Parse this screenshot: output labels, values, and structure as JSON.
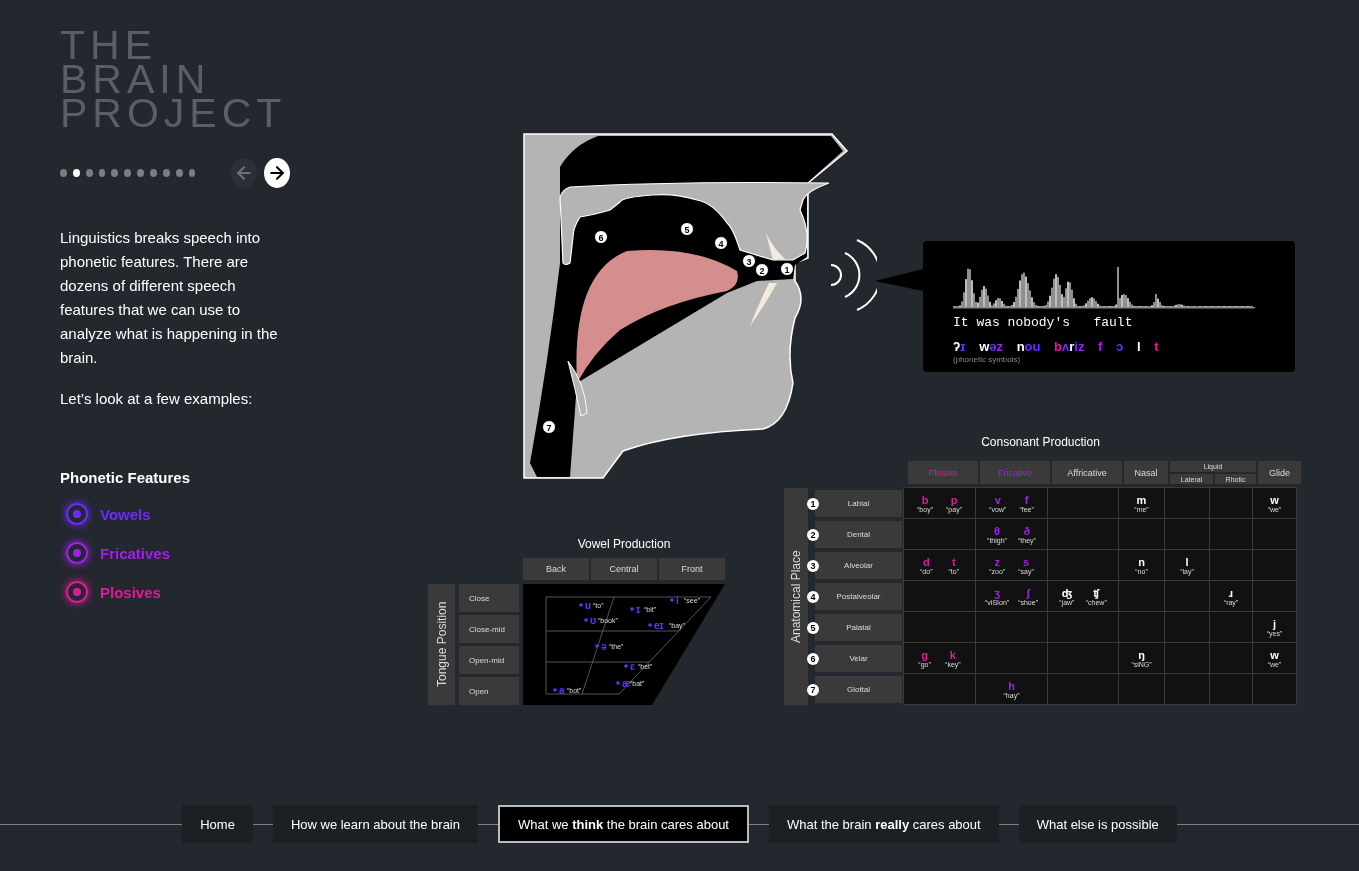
{
  "title": [
    "THE",
    "BRAIN",
    "PROJECT"
  ],
  "pager": {
    "dots": [
      {
        "selected": false
      },
      {
        "selected": true
      },
      {
        "selected": false
      },
      {
        "selected": false
      },
      {
        "selected": false
      },
      {
        "selected": false
      },
      {
        "selected": false
      },
      {
        "selected": false
      },
      {
        "selected": false
      },
      {
        "selected": false
      },
      {
        "selected": false
      }
    ],
    "prev": {
      "disabled": true
    },
    "next": {
      "disabled": false
    }
  },
  "intro": "Linguistics breaks speech into phonetic features. There are dozens of different speech features that we can use to analyze what is happening in the brain.",
  "prompt": "Let’s look at a few examples:",
  "features": {
    "heading": "Phonetic Features",
    "items": [
      {
        "label": "Vowels",
        "kind": "vowel",
        "color": "#6a2cff"
      },
      {
        "label": "Fricatives",
        "kind": "fricative",
        "color": "#a020e8"
      },
      {
        "label": "Plosives",
        "kind": "plosive",
        "color": "#e0199a"
      }
    ]
  },
  "tract": {
    "markers": [
      "1",
      "2",
      "3",
      "4",
      "5",
      "6",
      "7"
    ]
  },
  "speech": {
    "sentence": "It was nobody's   fault",
    "words": [
      {
        "segments": [
          {
            "text": "ʔ",
            "kind": "other"
          },
          {
            "text": "ɪ",
            "kind": "vowel"
          }
        ]
      },
      {
        "segments": [
          {
            "text": "w",
            "kind": "other"
          },
          {
            "text": "ə",
            "kind": "vowel"
          },
          {
            "text": "z",
            "kind": "fricative"
          }
        ]
      },
      {
        "segments": [
          {
            "text": "n",
            "kind": "other"
          },
          {
            "text": "ou",
            "kind": "vowel"
          }
        ]
      },
      {
        "segments": [
          {
            "text": "b",
            "kind": "plosive"
          },
          {
            "text": "ʌ",
            "kind": "vowel"
          },
          {
            "text": "r",
            "kind": "other"
          },
          {
            "text": "i",
            "kind": "vowel"
          },
          {
            "text": "z",
            "kind": "fricative"
          }
        ]
      },
      {
        "segments": [
          {
            "text": "f",
            "kind": "fricative"
          }
        ]
      },
      {
        "segments": [
          {
            "text": "ɔ",
            "kind": "vowel"
          }
        ]
      },
      {
        "segments": [
          {
            "text": "l",
            "kind": "other"
          }
        ]
      },
      {
        "segments": [
          {
            "text": "t",
            "kind": "plosive"
          }
        ]
      }
    ],
    "caption": "(phonetic symbols)"
  },
  "vowel_chart": {
    "title": "Vowel Production",
    "axis_label": "Tongue Position",
    "columns": [
      "Back",
      "Central",
      "Front"
    ],
    "rows": [
      "Close",
      "Close-mid",
      "Open-mid",
      "Open"
    ],
    "vowels": [
      {
        "symbol": "u",
        "example": "“to”"
      },
      {
        "symbol": "ɪ",
        "example": "“bit”"
      },
      {
        "symbol": "i",
        "example": "“see”"
      },
      {
        "symbol": "ʊ",
        "example": "“book”"
      },
      {
        "symbol": "eɪ",
        "example": "“bay”"
      },
      {
        "symbol": "ə",
        "example": "“the”"
      },
      {
        "symbol": "ɛ",
        "example": "“bet”"
      },
      {
        "symbol": "æ",
        "example": "“bat”"
      },
      {
        "symbol": "a",
        "example": "“bot”"
      }
    ]
  },
  "consonant_chart": {
    "title": "Consonant Production",
    "axis_label": "Anatomical Place",
    "group_label": "Liquid",
    "columns": [
      {
        "label": "Plosive",
        "kind": "plosive",
        "group": false
      },
      {
        "label": "Fricative",
        "kind": "fricative",
        "group": false
      },
      {
        "label": "Affricative",
        "kind": "affricative",
        "group": false
      },
      {
        "label": "Nasal",
        "kind": "nasal",
        "group": false
      },
      {
        "label": "Lateral",
        "kind": "lateral",
        "group": true
      },
      {
        "label": "Rhotic",
        "kind": "rhotic",
        "group": true
      },
      {
        "label": "Glide",
        "kind": "glide",
        "group": false
      }
    ],
    "rows": [
      {
        "number": "1",
        "place": "Labial",
        "phones": [
          {
            "symbol": "b",
            "example": "“boy”",
            "kind": "plosive"
          },
          {
            "symbol": "p",
            "example": "“pay”",
            "kind": "plosive"
          },
          {
            "symbol": "v",
            "example": "“vow”",
            "kind": "fricative"
          },
          {
            "symbol": "f",
            "example": "“fee”",
            "kind": "fricative"
          },
          {
            "symbol": "m",
            "example": "“me”",
            "kind": "nasal"
          },
          {
            "symbol": "w",
            "example": "“we”",
            "kind": "glide"
          }
        ]
      },
      {
        "number": "2",
        "place": "Dental",
        "phones": [
          {
            "symbol": "θ",
            "example": "“thigh”",
            "kind": "fricative"
          },
          {
            "symbol": "ð",
            "example": "“they”",
            "kind": "fricative"
          }
        ]
      },
      {
        "number": "3",
        "place": "Alveolar",
        "phones": [
          {
            "symbol": "d",
            "example": "“do”",
            "kind": "plosive"
          },
          {
            "symbol": "t",
            "example": "“to”",
            "kind": "plosive"
          },
          {
            "symbol": "z",
            "example": "“zoo”",
            "kind": "fricative"
          },
          {
            "symbol": "s",
            "example": "“say”",
            "kind": "fricative"
          },
          {
            "symbol": "n",
            "example": "“no”",
            "kind": "nasal"
          },
          {
            "symbol": "l",
            "example": "“lay”",
            "kind": "lateral"
          }
        ]
      },
      {
        "number": "4",
        "place": "Postalveolar",
        "phones": [
          {
            "symbol": "ʒ",
            "example": "“viSIon”",
            "kind": "fricative"
          },
          {
            "symbol": "ʃ",
            "example": "“shoe”",
            "kind": "fricative"
          },
          {
            "symbol": "ʤ",
            "example": "“jaw”",
            "kind": "affricative"
          },
          {
            "symbol": "ʧ",
            "example": "“chew”",
            "kind": "affricative"
          },
          {
            "symbol": "ɹ",
            "example": "“ray”",
            "kind": "rhotic"
          }
        ]
      },
      {
        "number": "5",
        "place": "Palatal",
        "phones": [
          {
            "symbol": "j",
            "example": "“yes”",
            "kind": "glide"
          }
        ]
      },
      {
        "number": "6",
        "place": "Velar",
        "phones": [
          {
            "symbol": "g",
            "example": "“go”",
            "kind": "plosive"
          },
          {
            "symbol": "k",
            "example": "“key”",
            "kind": "plosive"
          },
          {
            "symbol": "ŋ",
            "example": "“siNG”",
            "kind": "nasal"
          },
          {
            "symbol": "w",
            "example": "“we”",
            "kind": "glide"
          }
        ]
      },
      {
        "number": "7",
        "place": "Glottal",
        "phones": [
          {
            "symbol": "h",
            "example": "“hay”",
            "kind": "fricative"
          }
        ]
      }
    ]
  },
  "nav": [
    {
      "label": "Home",
      "selected": false
    },
    {
      "label": "How we learn about the brain",
      "selected": false
    },
    {
      "label": "What we **think** the brain cares about",
      "selected": true
    },
    {
      "label": "What the brain **really** cares about",
      "selected": false
    },
    {
      "label": "What else is possible",
      "selected": false
    }
  ]
}
